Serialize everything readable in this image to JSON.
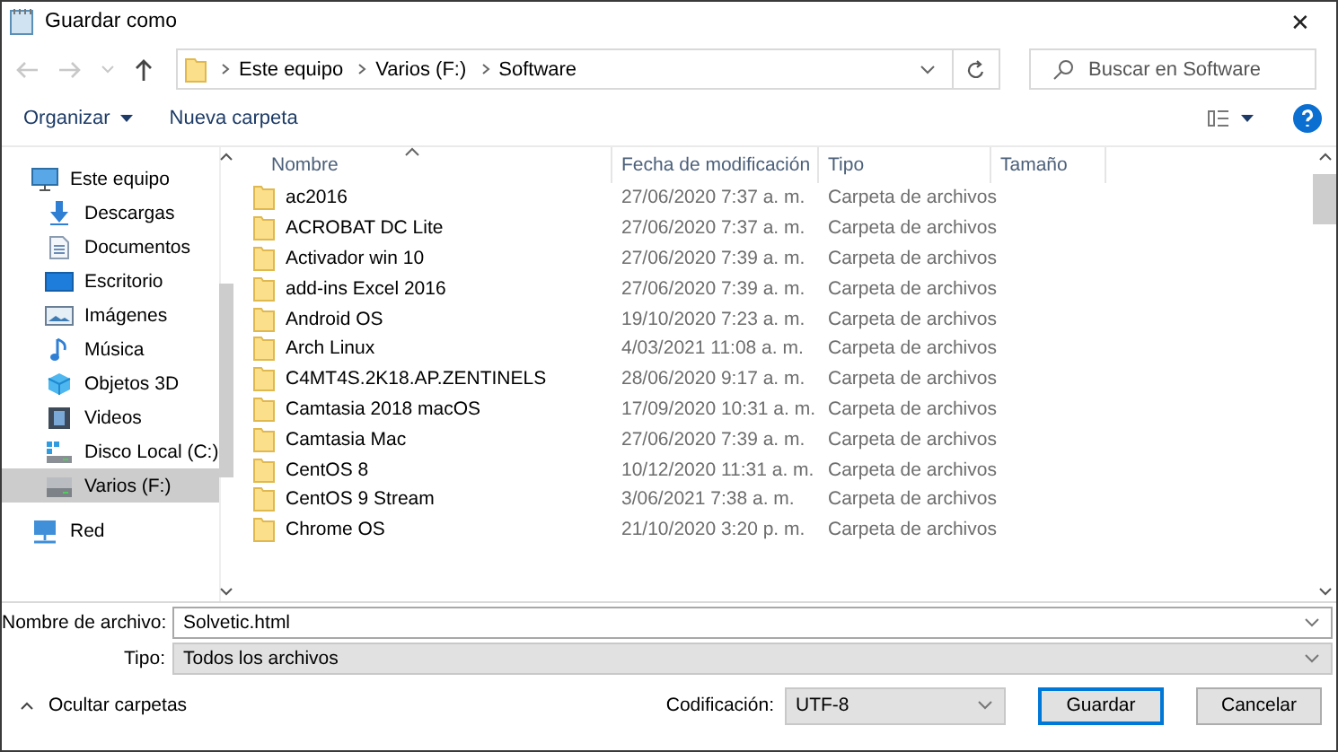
{
  "window": {
    "title": "Guardar como",
    "close": "✕"
  },
  "address": {
    "crumbs": [
      "Este equipo",
      "Varios (F:)",
      "Software"
    ]
  },
  "search": {
    "placeholder": "Buscar en Software"
  },
  "toolbar": {
    "organize": "Organizar",
    "new_folder": "Nueva carpeta"
  },
  "sidebar": {
    "items": [
      {
        "label": "Este equipo",
        "kind": "computer",
        "selected": false,
        "children": [
          {
            "label": "Descargas",
            "kind": "downloads",
            "selected": false
          },
          {
            "label": "Documentos",
            "kind": "documents",
            "selected": false
          },
          {
            "label": "Escritorio",
            "kind": "desktop",
            "selected": false
          },
          {
            "label": "Imágenes",
            "kind": "pictures",
            "selected": false
          },
          {
            "label": "Música",
            "kind": "music",
            "selected": false
          },
          {
            "label": "Objetos 3D",
            "kind": "objects3d",
            "selected": false
          },
          {
            "label": "Videos",
            "kind": "videos",
            "selected": false
          },
          {
            "label": "Disco Local (C:)",
            "kind": "system_drive",
            "selected": false
          },
          {
            "label": "Varios (F:)",
            "kind": "drive",
            "selected": true
          }
        ]
      },
      {
        "label": "Red",
        "kind": "network",
        "selected": false
      }
    ]
  },
  "table": {
    "columns": [
      {
        "label": "Nombre",
        "sorted": true
      },
      {
        "label": "Fecha de modificación",
        "sorted": false
      },
      {
        "label": "Tipo",
        "sorted": false
      },
      {
        "label": "Tamaño",
        "sorted": false
      }
    ],
    "rows": [
      {
        "name": "ac2016",
        "date": "27/06/2020 7:37 a. m.",
        "type": "Carpeta de archivos"
      },
      {
        "name": "ACROBAT DC Lite",
        "date": "27/06/2020 7:37 a. m.",
        "type": "Carpeta de archivos"
      },
      {
        "name": "Activador win 10",
        "date": "27/06/2020 7:39 a. m.",
        "type": "Carpeta de archivos"
      },
      {
        "name": "add-ins Excel 2016",
        "date": "27/06/2020 7:39 a. m.",
        "type": "Carpeta de archivos"
      },
      {
        "name": "Android OS",
        "date": "19/10/2020 7:23 a. m.",
        "type": "Carpeta de archivos"
      },
      {
        "name": "Arch Linux",
        "date": "4/03/2021 11:08 a. m.",
        "type": "Carpeta de archivos"
      },
      {
        "name": "C4MT4S.2K18.AP.ZENTINELS",
        "date": "28/06/2020 9:17 a. m.",
        "type": "Carpeta de archivos"
      },
      {
        "name": "Camtasia 2018 macOS",
        "date": "17/09/2020 10:31 a. m.",
        "type": "Carpeta de archivos"
      },
      {
        "name": "Camtasia Mac",
        "date": "27/06/2020 7:39 a. m.",
        "type": "Carpeta de archivos"
      },
      {
        "name": "CentOS 8",
        "date": "10/12/2020 11:31 a. m.",
        "type": "Carpeta de archivos"
      },
      {
        "name": "CentOS 9 Stream",
        "date": "3/06/2021 7:38 a. m.",
        "type": "Carpeta de archivos"
      },
      {
        "name": "Chrome OS",
        "date": "21/10/2020 3:20 p. m.",
        "type": "Carpeta de archivos"
      }
    ]
  },
  "file_name": {
    "label": "Nombre de archivo:",
    "value": "Solvetic.html"
  },
  "file_type": {
    "label": "Tipo:",
    "value": "Todos los archivos"
  },
  "footer": {
    "hide_folders": "Ocultar carpetas",
    "encoding_label": "Codificación:",
    "encoding": "UTF-8",
    "save": "Guardar",
    "cancel": "Cancelar"
  }
}
